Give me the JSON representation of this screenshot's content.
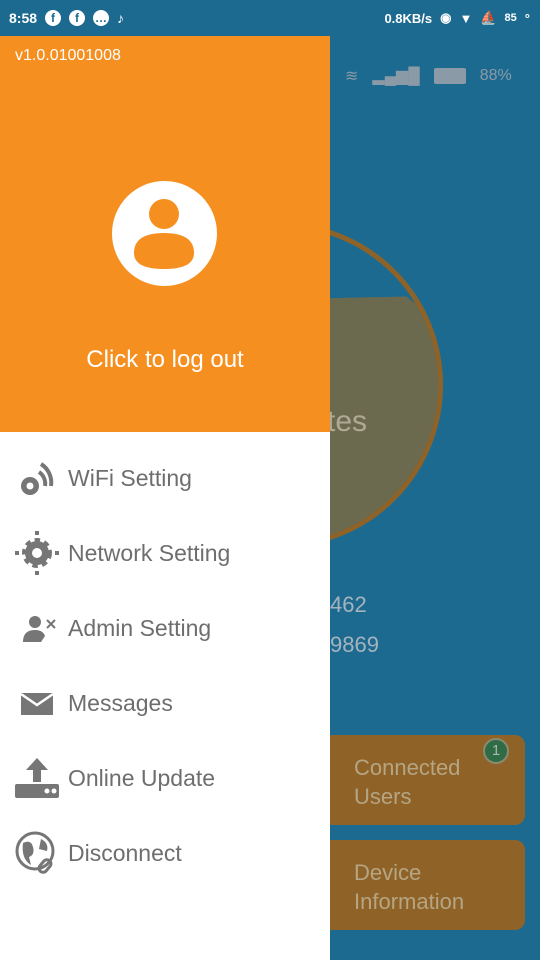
{
  "status_bar": {
    "time": "8:58",
    "speed": "0.8KB/s",
    "battery": "85",
    "notif_icons": [
      "facebook-icon",
      "facebook-icon",
      "chat-icon",
      "tiktok-icon"
    ]
  },
  "background": {
    "battery_pct": "88%",
    "chart_label_fragment": "tes",
    "value1_fragment": "462",
    "value2_fragment": "9869",
    "cards": [
      {
        "label_line1": "Connected",
        "label_line2": "Users",
        "badge": "1"
      },
      {
        "label_line1": "Device",
        "label_line2": "Information"
      }
    ]
  },
  "drawer": {
    "version": "v1.0.01001008",
    "logout_label": "Click to log out",
    "items": [
      {
        "label": "WiFi Setting",
        "icon": "wifi-gear-icon"
      },
      {
        "label": "Network Setting",
        "icon": "gear-icon"
      },
      {
        "label": "Admin Setting",
        "icon": "admin-icon"
      },
      {
        "label": "Messages",
        "icon": "envelope-icon"
      },
      {
        "label": "Online Update",
        "icon": "upload-icon"
      },
      {
        "label": "Disconnect",
        "icon": "globe-link-icon"
      }
    ]
  },
  "colors": {
    "drawer_header": "#f58f20",
    "background": "#1d6a91",
    "icon": "#767676"
  }
}
